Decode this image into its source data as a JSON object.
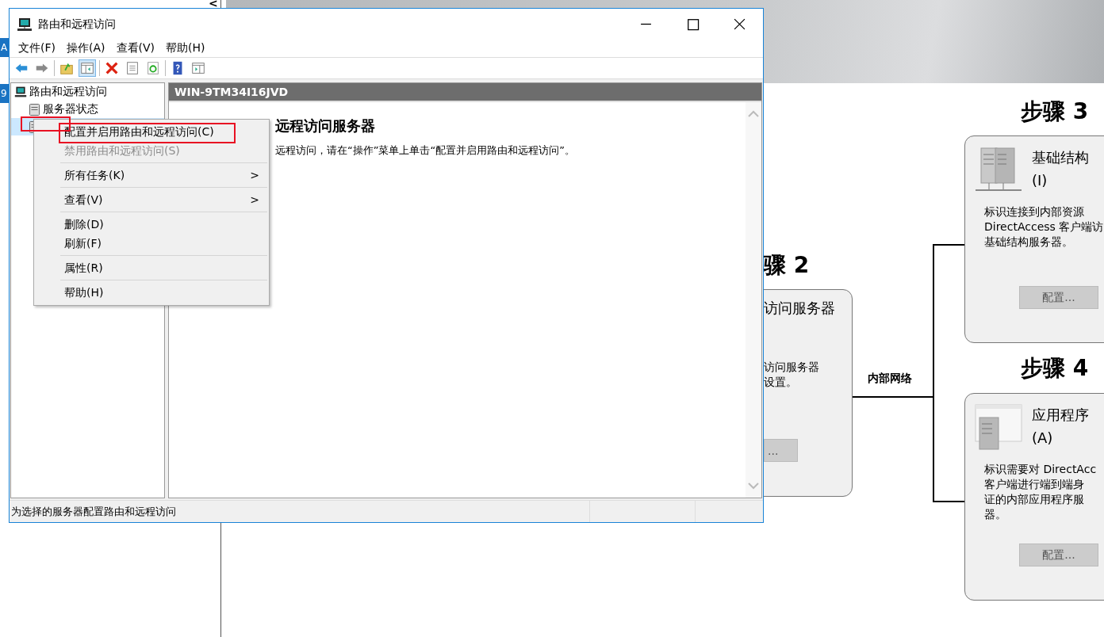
{
  "background": {
    "back_caret": "<",
    "side_tabs": [
      {
        "label": "A"
      },
      {
        "label": "9"
      }
    ],
    "steps": [
      {
        "heading": "骤 2",
        "title": "访问服务器",
        "lines": [
          "访问服务器",
          "设置。"
        ],
        "button": "..."
      },
      {
        "heading": "步骤 3",
        "title": "基础结构",
        "subtitle": "(I)",
        "lines": [
          "标识连接到内部资源",
          "DirectAccess 客户端访",
          "基础结构服务器。"
        ],
        "button": "配置..."
      },
      {
        "heading": "步骤 4",
        "title": "应用程序",
        "subtitle": "(A)",
        "lines": [
          "标识需要对 DirectAcc",
          "客户端进行端到端身",
          "证的内部应用程序服",
          "器。"
        ],
        "button": "配置..."
      }
    ],
    "network_label": "内部网络"
  },
  "window": {
    "title": "路由和远程访问",
    "menu": [
      "文件(F)",
      "操作(A)",
      "查看(V)",
      "帮助(H)"
    ],
    "toolbar": [
      {
        "kind": "back",
        "pressed": false
      },
      {
        "kind": "forward",
        "pressed": false
      },
      {
        "kind": "separator"
      },
      {
        "kind": "up",
        "pressed": false
      },
      {
        "kind": "tree",
        "pressed": true
      },
      {
        "kind": "separator"
      },
      {
        "kind": "delete",
        "pressed": false
      },
      {
        "kind": "properties",
        "pressed": false
      },
      {
        "kind": "refresh",
        "pressed": false
      },
      {
        "kind": "separator"
      },
      {
        "kind": "help",
        "pressed": false
      },
      {
        "kind": "panel",
        "pressed": false
      }
    ],
    "tree": {
      "label": "路由和远程访问",
      "children": [
        {
          "label": "服务器状态",
          "selected": false
        },
        {
          "selected": true
        }
      ]
    },
    "pane_header": "WIN-9TM34I16JVD",
    "content_heading": "远程访问服务器",
    "content_text": "远程访问，请在“操作”菜单上单击“配置并启用路由和远程访问”。",
    "status_bar": "为选择的服务器配置路由和远程访问"
  },
  "context_menu": [
    {
      "kind": "item",
      "label": "配置并启用路由和远程访问(C)",
      "disabled": false
    },
    {
      "kind": "item",
      "label": "禁用路由和远程访问(S)",
      "disabled": true
    },
    {
      "kind": "separator"
    },
    {
      "kind": "item",
      "label": "所有任务(K)",
      "disabled": false,
      "arrow": ">"
    },
    {
      "kind": "separator"
    },
    {
      "kind": "item",
      "label": "查看(V)",
      "disabled": false,
      "arrow": ">"
    },
    {
      "kind": "separator"
    },
    {
      "kind": "item",
      "label": "删除(D)",
      "disabled": false
    },
    {
      "kind": "item",
      "label": "刷新(F)",
      "disabled": false
    },
    {
      "kind": "separator"
    },
    {
      "kind": "item",
      "label": "属性(R)",
      "disabled": false
    },
    {
      "kind": "separator"
    },
    {
      "kind": "item",
      "label": "帮助(H)",
      "disabled": false
    }
  ]
}
